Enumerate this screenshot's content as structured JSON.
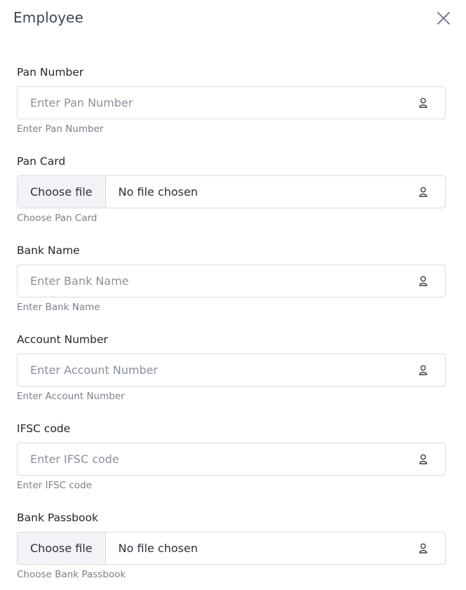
{
  "modal": {
    "title": "Employee",
    "close_icon": "close-icon"
  },
  "fields": [
    {
      "label": "Pan Number",
      "type": "text",
      "placeholder": "Enter Pan Number",
      "value": "",
      "hint": "Enter Pan Number",
      "icon": "user-icon"
    },
    {
      "label": "Pan Card",
      "type": "file",
      "button_label": "Choose file",
      "status": "No file chosen",
      "hint": "Choose Pan Card",
      "icon": "user-icon"
    },
    {
      "label": "Bank Name",
      "type": "text",
      "placeholder": "Enter Bank Name",
      "value": "",
      "hint": "Enter Bank Name",
      "icon": "user-icon"
    },
    {
      "label": "Account Number",
      "type": "text",
      "placeholder": "Enter Account Number",
      "value": "",
      "hint": "Enter Account Number",
      "icon": "user-icon"
    },
    {
      "label": "IFSC code",
      "type": "text",
      "placeholder": "Enter IFSC code",
      "value": "",
      "hint": "Enter IFSC code",
      "icon": "user-icon"
    },
    {
      "label": "Bank Passbook",
      "type": "file",
      "button_label": "Choose file",
      "status": "No file chosen",
      "hint": "Choose Bank Passbook",
      "icon": "user-icon"
    }
  ],
  "colors": {
    "border": "#d8dbe0",
    "file_button_bg": "#f1f3f6",
    "hint_text": "#7a8089",
    "placeholder_text": "#8b9098"
  }
}
